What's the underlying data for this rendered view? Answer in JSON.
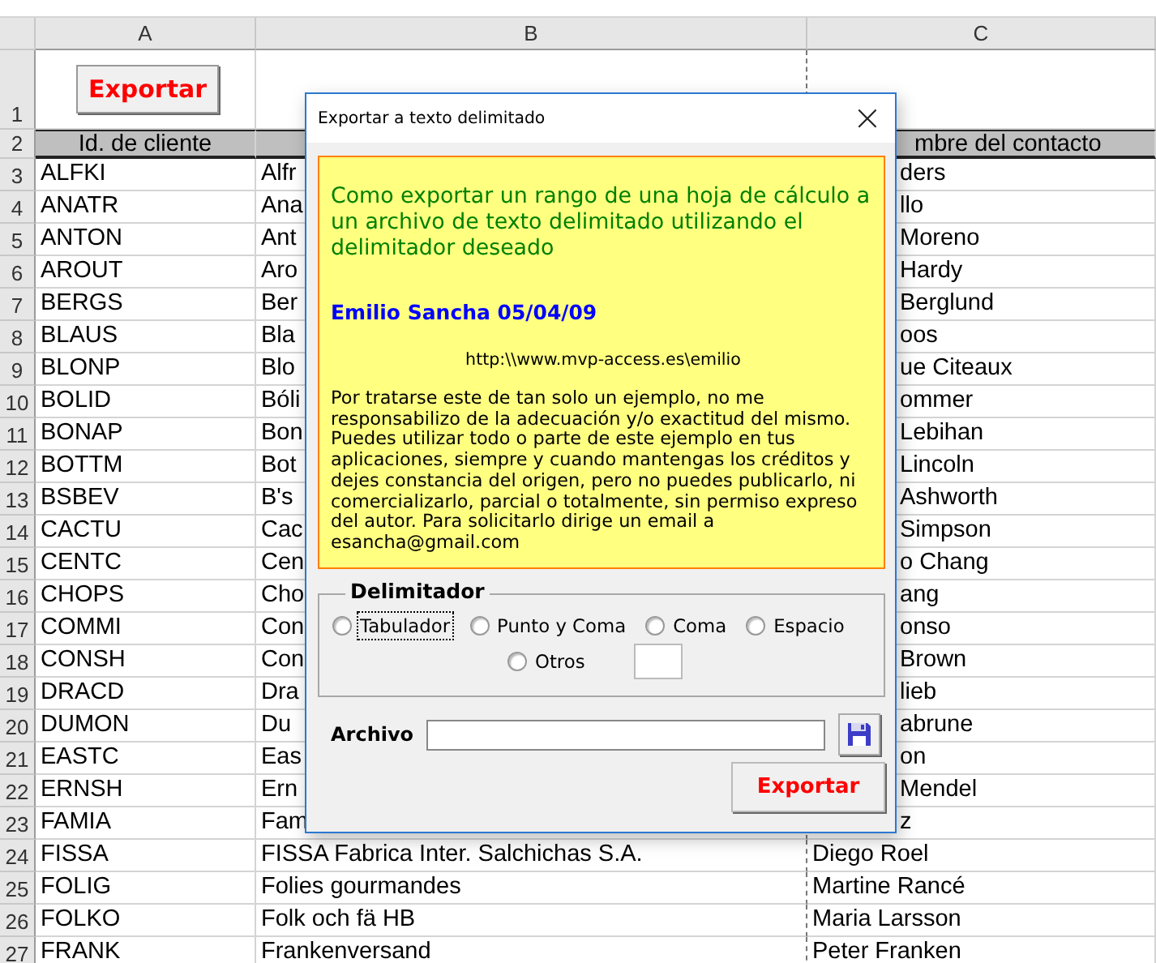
{
  "sheet": {
    "column_headers": [
      "A",
      "B",
      "C"
    ],
    "rows": [
      {
        "number": "1",
        "kind": "button",
        "label": "Exportar"
      },
      {
        "number": "2",
        "kind": "header",
        "a": "Id. de cliente",
        "c": "mbre del contacto"
      },
      {
        "number": "3",
        "kind": "covered",
        "a": "ALFKI",
        "b": "Alfr",
        "c": "ders"
      },
      {
        "number": "4",
        "kind": "covered",
        "a": "ANATR",
        "b": "Ana",
        "c": "llo"
      },
      {
        "number": "5",
        "kind": "covered",
        "a": "ANTON",
        "b": "Ant",
        "c": "Moreno"
      },
      {
        "number": "6",
        "kind": "covered",
        "a": "AROUT",
        "b": "Aro",
        "c": "Hardy"
      },
      {
        "number": "7",
        "kind": "covered",
        "a": "BERGS",
        "b": "Ber",
        "c": "Berglund"
      },
      {
        "number": "8",
        "kind": "covered",
        "a": "BLAUS",
        "b": "Bla",
        "c": "oos"
      },
      {
        "number": "9",
        "kind": "covered",
        "a": "BLONP",
        "b": "Blo",
        "c": "ue Citeaux"
      },
      {
        "number": "10",
        "kind": "covered",
        "a": "BOLID",
        "b": "Bóli",
        "c": "ommer"
      },
      {
        "number": "11",
        "kind": "covered",
        "a": "BONAP",
        "b": "Bon",
        "c": "Lebihan"
      },
      {
        "number": "12",
        "kind": "covered",
        "a": "BOTTM",
        "b": "Bot",
        "c": "Lincoln"
      },
      {
        "number": "13",
        "kind": "covered",
        "a": "BSBEV",
        "b": "B's",
        "c": "Ashworth"
      },
      {
        "number": "14",
        "kind": "covered",
        "a": "CACTU",
        "b": "Cac",
        "c": "Simpson"
      },
      {
        "number": "15",
        "kind": "covered",
        "a": "CENTC",
        "b": "Cen",
        "c": "o Chang"
      },
      {
        "number": "16",
        "kind": "covered",
        "a": "CHOPS",
        "b": "Cho",
        "c": "ang"
      },
      {
        "number": "17",
        "kind": "covered",
        "a": "COMMI",
        "b": "Con",
        "c": "onso"
      },
      {
        "number": "18",
        "kind": "covered",
        "a": "CONSH",
        "b": "Con",
        "c": "Brown"
      },
      {
        "number": "19",
        "kind": "covered",
        "a": "DRACD",
        "b": "Dra",
        "c": "lieb"
      },
      {
        "number": "20",
        "kind": "covered",
        "a": "DUMON",
        "b": "Du",
        "c": "abrune"
      },
      {
        "number": "21",
        "kind": "covered",
        "a": "EASTC",
        "b": "Eas",
        "c": "on"
      },
      {
        "number": "22",
        "kind": "covered",
        "a": "ERNSH",
        "b": "Ern",
        "c": "Mendel"
      },
      {
        "number": "23",
        "kind": "covered",
        "a": "FAMIA",
        "b": "Fam",
        "c": "z"
      },
      {
        "number": "24",
        "kind": "data",
        "a": "FISSA",
        "b": "FISSA Fabrica Inter. Salchichas S.A.",
        "c": "Diego Roel"
      },
      {
        "number": "25",
        "kind": "data",
        "a": "FOLIG",
        "b": "Folies gourmandes",
        "c": "Martine Rancé"
      },
      {
        "number": "26",
        "kind": "data",
        "a": "FOLKO",
        "b": "Folk och fä HB",
        "c": "Maria Larsson"
      },
      {
        "number": "27",
        "kind": "data",
        "a": "FRANK",
        "b": "Frankenversand",
        "c": "Peter Franken"
      }
    ]
  },
  "dialog": {
    "title": "Exportar a texto delimitado",
    "close": "×",
    "info": {
      "heading": "Como exportar un rango de una hoja de cálculo a un archivo de texto delimitado utilizando el delimitador deseado",
      "author": "Emilio Sancha 05/04/09",
      "url": "http:\\\\www.mvp-access.es\\emilio",
      "notice": "Por tratarse este de tan solo un ejemplo, no me responsabilizo de la adecuación y/o exactitud del mismo. Puedes utilizar todo o parte de este ejemplo en tus aplicaciones, siempre y cuando mantengas los créditos y dejes constancia del origen, pero no puedes publicarlo, ni comercializarlo, parcial o totalmente, sin permiso expreso del autor. Para solicitarlo dirige un email a esancha@gmail.com"
    },
    "delimiter": {
      "legend": "Delimitador",
      "options": [
        {
          "label": "Tabulador",
          "selected": false,
          "focused": true
        },
        {
          "label": "Punto y Coma",
          "selected": false,
          "focused": false
        },
        {
          "label": "Coma",
          "selected": false,
          "focused": false
        },
        {
          "label": "Espacio",
          "selected": false,
          "focused": false
        },
        {
          "label": "Otros",
          "selected": false,
          "focused": false
        }
      ]
    },
    "file_label": "Archivo",
    "export_button": "Exportar"
  }
}
